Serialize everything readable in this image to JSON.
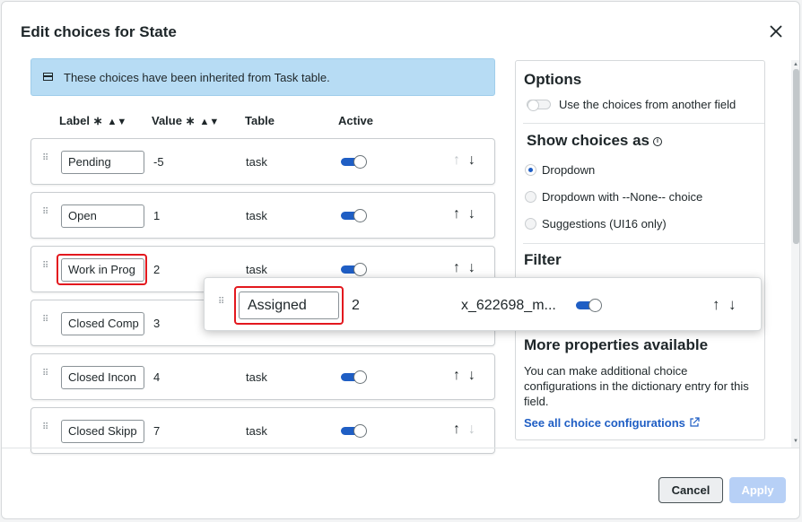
{
  "dialog": {
    "title": "Edit choices for State",
    "banner": "These choices have been inherited from Task table."
  },
  "columns": {
    "label": "Label",
    "value": "Value",
    "table": "Table",
    "active": "Active"
  },
  "rows": [
    {
      "label": "Pending",
      "value": "-5",
      "table": "task",
      "active": true
    },
    {
      "label": "Open",
      "value": "1",
      "table": "task",
      "active": true
    },
    {
      "label": "Work in Prog",
      "value": "2",
      "table": "task",
      "active": true
    },
    {
      "label": "Closed Comp",
      "value": "3",
      "table": "",
      "active": true
    },
    {
      "label": "Closed Incon",
      "value": "4",
      "table": "task",
      "active": true
    },
    {
      "label": "Closed Skipp",
      "value": "7",
      "table": "task",
      "active": true
    }
  ],
  "dragged_row": {
    "label": "Assigned",
    "value": "2",
    "table": "x_622698_m...",
    "active": true
  },
  "options": {
    "title": "Options",
    "use_other_field": "Use the choices from another field",
    "show_choices_title": "Show choices as",
    "radios": [
      "Dropdown",
      "Dropdown with --None-- choice",
      "Suggestions (UI16 only)"
    ],
    "selected_radio": "Dropdown",
    "filter_title": "Filter",
    "more_title": "More properties available",
    "more_text": "You can make additional choice configurations in the dictionary entry for this field.",
    "link": "See all choice configurations"
  },
  "footer": {
    "cancel": "Cancel",
    "apply": "Apply"
  },
  "icons": {
    "close": "close-icon",
    "table": "table-icon",
    "sort": "sort-icon",
    "grip": "drag-handle-icon",
    "up": "arrow-up-icon",
    "down": "arrow-down-icon",
    "info": "info-icon",
    "external": "external-link-icon"
  },
  "colors": {
    "accent": "#1f5ec4",
    "highlight": "#e3181e",
    "banner": "#b7dcf4"
  }
}
